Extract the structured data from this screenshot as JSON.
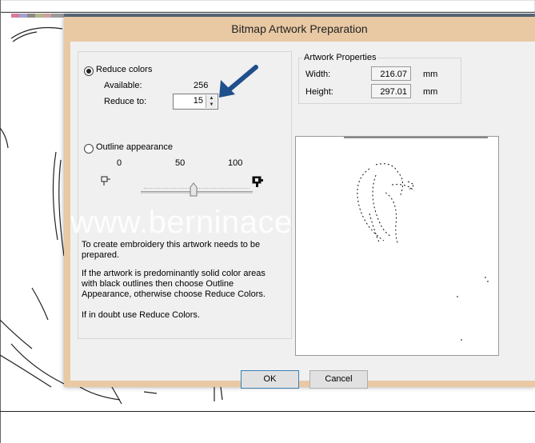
{
  "dialog": {
    "title": "Bitmap Artwork Preparation",
    "reduce_colors": {
      "label": "Reduce colors",
      "selected": true,
      "available_label": "Available:",
      "available_value": "256",
      "reduce_to_label": "Reduce to:",
      "reduce_to_value": "15"
    },
    "outline_appearance": {
      "label": "Outline appearance",
      "selected": false,
      "slider_min": "0",
      "slider_mid": "50",
      "slider_max": "100",
      "slider_value": 50
    },
    "artwork_properties": {
      "legend": "Artwork Properties",
      "width_label": "Width:",
      "width_value": "216.07",
      "width_unit": "mm",
      "height_label": "Height:",
      "height_value": "297.01",
      "height_unit": "mm"
    },
    "help_text": {
      "p1": "To create embroidery this artwork needs to be prepared.",
      "p2": "If the artwork is predominantly solid color areas with black outlines then choose Outline Appearance, otherwise choose Reduce Colors.",
      "p3": "If in doubt use Reduce Colors."
    },
    "ok_label": "OK",
    "cancel_label": "Cancel"
  },
  "watermark": "www.berninace",
  "colors": {
    "frame": "#e8c9a4",
    "client": "#f0f0f0",
    "arrow": "#1f4f8c",
    "default_button_border": "#3c7fb1"
  },
  "icons": {
    "small_outline": "outline-small-icon",
    "large_outline": "outline-large-icon",
    "annotation": "blue-arrow-icon"
  }
}
